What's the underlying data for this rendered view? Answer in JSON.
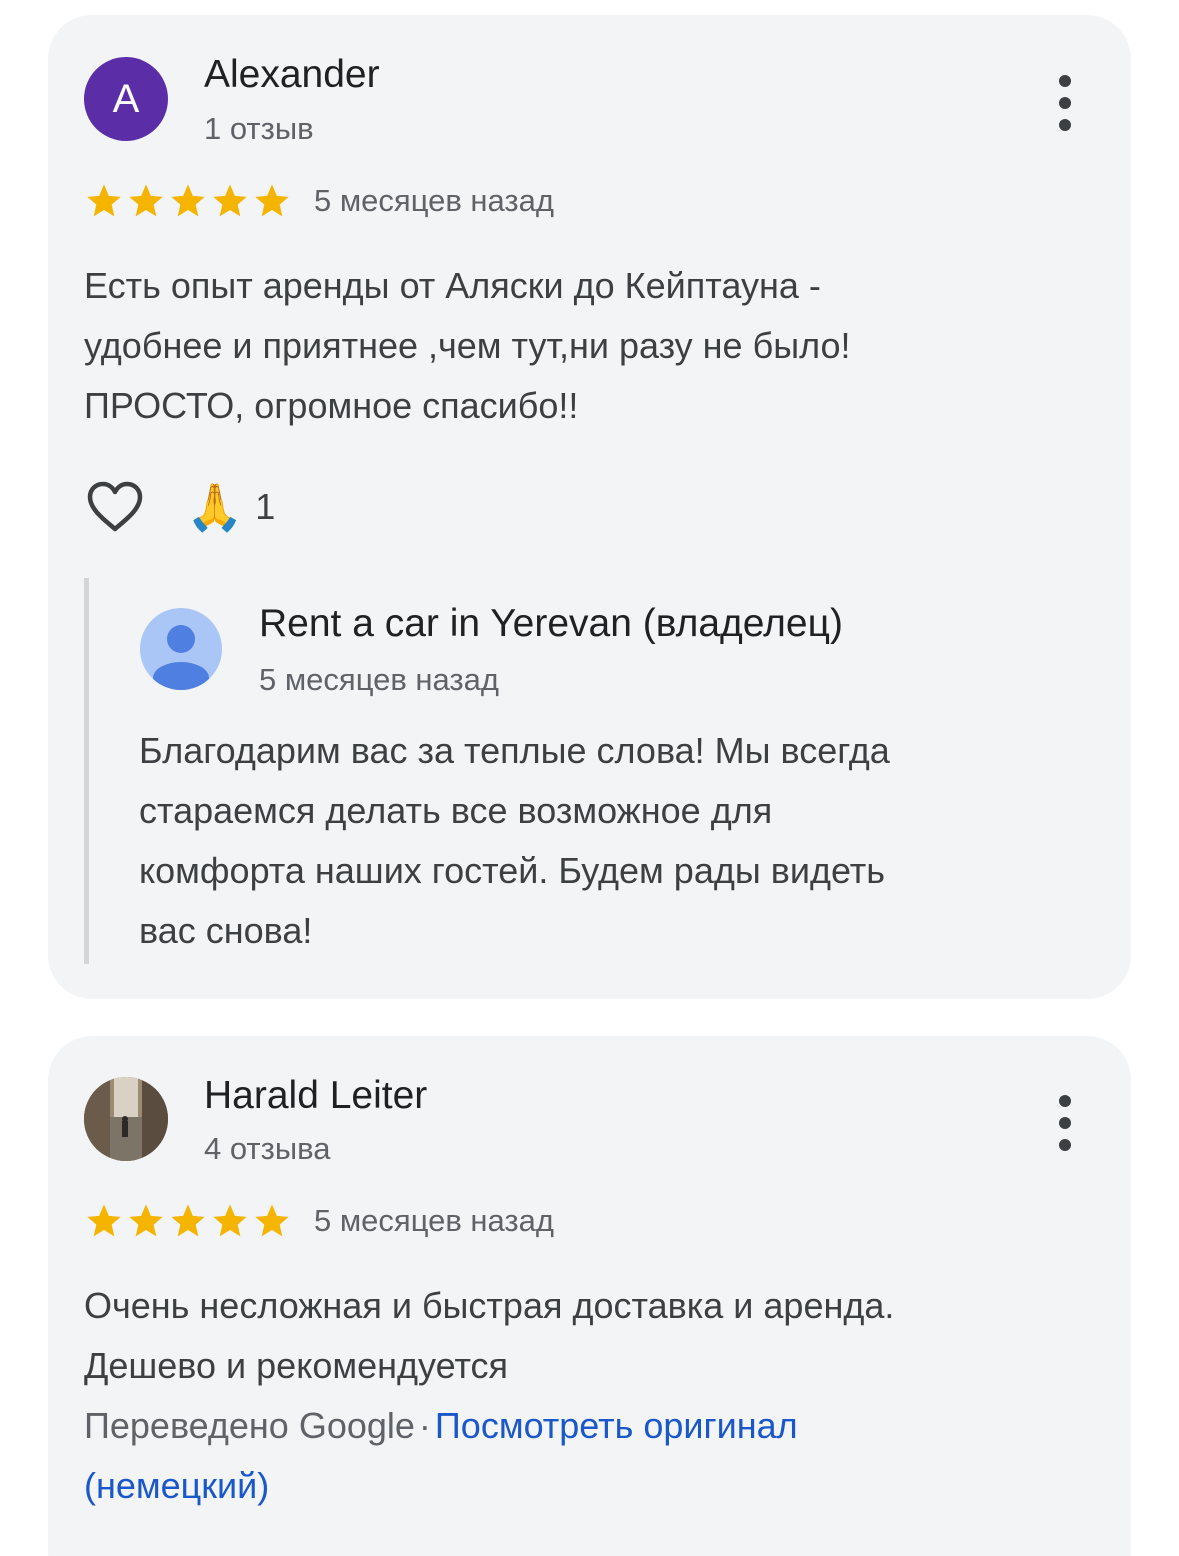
{
  "colors": {
    "star": "#f4b400",
    "link": "#1a57c9",
    "avatar_letter_bg": "#5b2ea8",
    "card_bg": "#f3f4f6"
  },
  "reviews": [
    {
      "author": "Alexander",
      "avatar_letter": "A",
      "review_count": "1 отзыв",
      "rating": 5,
      "date": "5 месяцев назад",
      "text_lines": [
        "Есть опыт аренды от Аляски до Кейптауна -",
        "удобнее и приятнее ,чем тут,ни разу не было!",
        "ПРОСТО, огромное спасибо!!"
      ],
      "reaction_emoji": "🙏",
      "reaction_count": "1",
      "owner_reply": {
        "name": "Rent a car in Yerevan (владелец)",
        "date": "5 месяцев назад",
        "text_lines": [
          "Благодарим вас за теплые слова! Мы всегда",
          "стараемся делать все возможное для",
          "комфорта наших гостей. Будем рады видеть",
          "вас снова!"
        ]
      }
    },
    {
      "author": "Harald Leiter",
      "review_count": "4 отзыва",
      "rating": 5,
      "date": "5 месяцев назад",
      "text_lines": [
        "Очень несложная и быстрая доставка и аренда.",
        "Дешево и рекомендуется"
      ],
      "translated_label": "Переведено Google",
      "separator": "·",
      "view_original_line1": "Посмотреть оригинал",
      "view_original_line2": "(немецкий)"
    }
  ]
}
